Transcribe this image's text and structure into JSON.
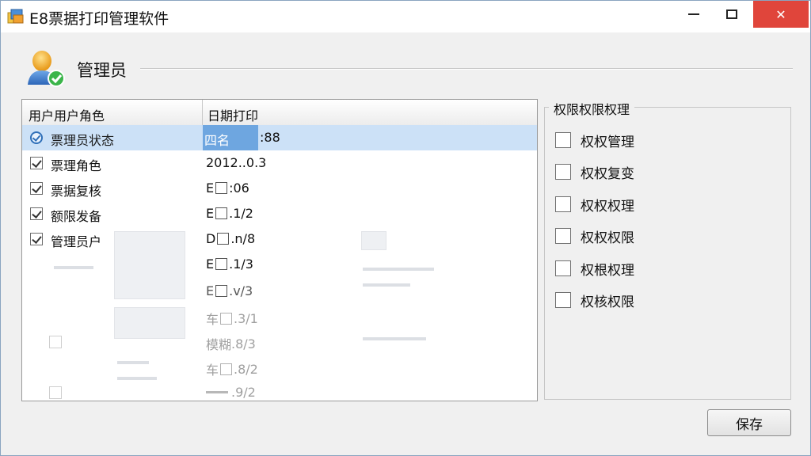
{
  "window": {
    "title": "E8票据打印管理软件",
    "close_glyph": "✕"
  },
  "header": {
    "title": "管理员"
  },
  "list": {
    "columns": [
      "用户用户角色",
      "日期打印"
    ],
    "rows": [
      {
        "name": "票理员状态",
        "date": "四名",
        "date_suffix": ":88",
        "state": "radio",
        "selected": true
      },
      {
        "name": "票理角色",
        "date": "2012..0.3",
        "state": "checked"
      },
      {
        "name": "票据复核",
        "date": "E",
        "date_suffix": ":06",
        "state": "checked"
      },
      {
        "name": "额限发备",
        "date": "E",
        "date_suffix": ".1/2",
        "state": "checked"
      },
      {
        "name": "管理员户",
        "date": "D",
        "date_suffix": ".n/8",
        "state": "checked"
      },
      {
        "name": "",
        "date": "E",
        "date_suffix": ".1/3",
        "state": "none"
      },
      {
        "name": "",
        "date": "E",
        "date_suffix": ".v/3",
        "state": "none",
        "faded": true
      },
      {
        "name": "",
        "date": "车",
        "date_suffix": ".3/1",
        "state": "none",
        "faded": true
      },
      {
        "name": "",
        "date": "模糊",
        "date_suffix": ".8/3",
        "state": "none",
        "faded": true
      },
      {
        "name": "",
        "date": "车",
        "date_suffix": ".8/2",
        "state": "none",
        "faded": true
      },
      {
        "name": "",
        "date": "",
        "date_suffix": ".9/2",
        "state": "none",
        "faded": true
      }
    ]
  },
  "permissions": {
    "title": "权限权限权理",
    "items": [
      "权权管理",
      "权权复变",
      "权权权理",
      "权权权限",
      "权根权理",
      "权核权限"
    ]
  },
  "buttons": {
    "save": "保存"
  },
  "colors": {
    "selection": "#cce1f7",
    "selected_cell": "#6ea6e0",
    "close_button": "#e0453b"
  }
}
